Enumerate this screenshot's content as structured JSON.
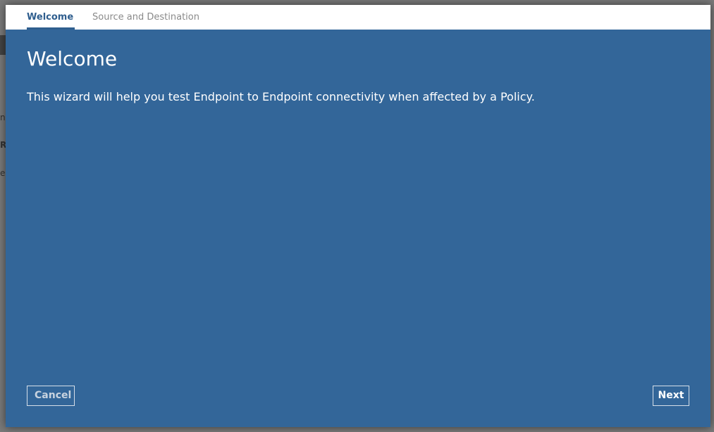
{
  "background": {
    "fragments": [
      "n",
      "R",
      "e"
    ]
  },
  "wizard": {
    "tabs": [
      {
        "label": "Welcome",
        "active": true
      },
      {
        "label": "Source and Destination",
        "active": false
      }
    ],
    "title": "Welcome",
    "description": "This wizard will help you test Endpoint to Endpoint connectivity when affected by a Policy.",
    "buttons": {
      "cancel": "Cancel",
      "next": "Next"
    }
  },
  "colors": {
    "modal_bg": "#336699",
    "active_tab": "#2f5e8e",
    "inactive_tab": "#8a8a8a"
  }
}
